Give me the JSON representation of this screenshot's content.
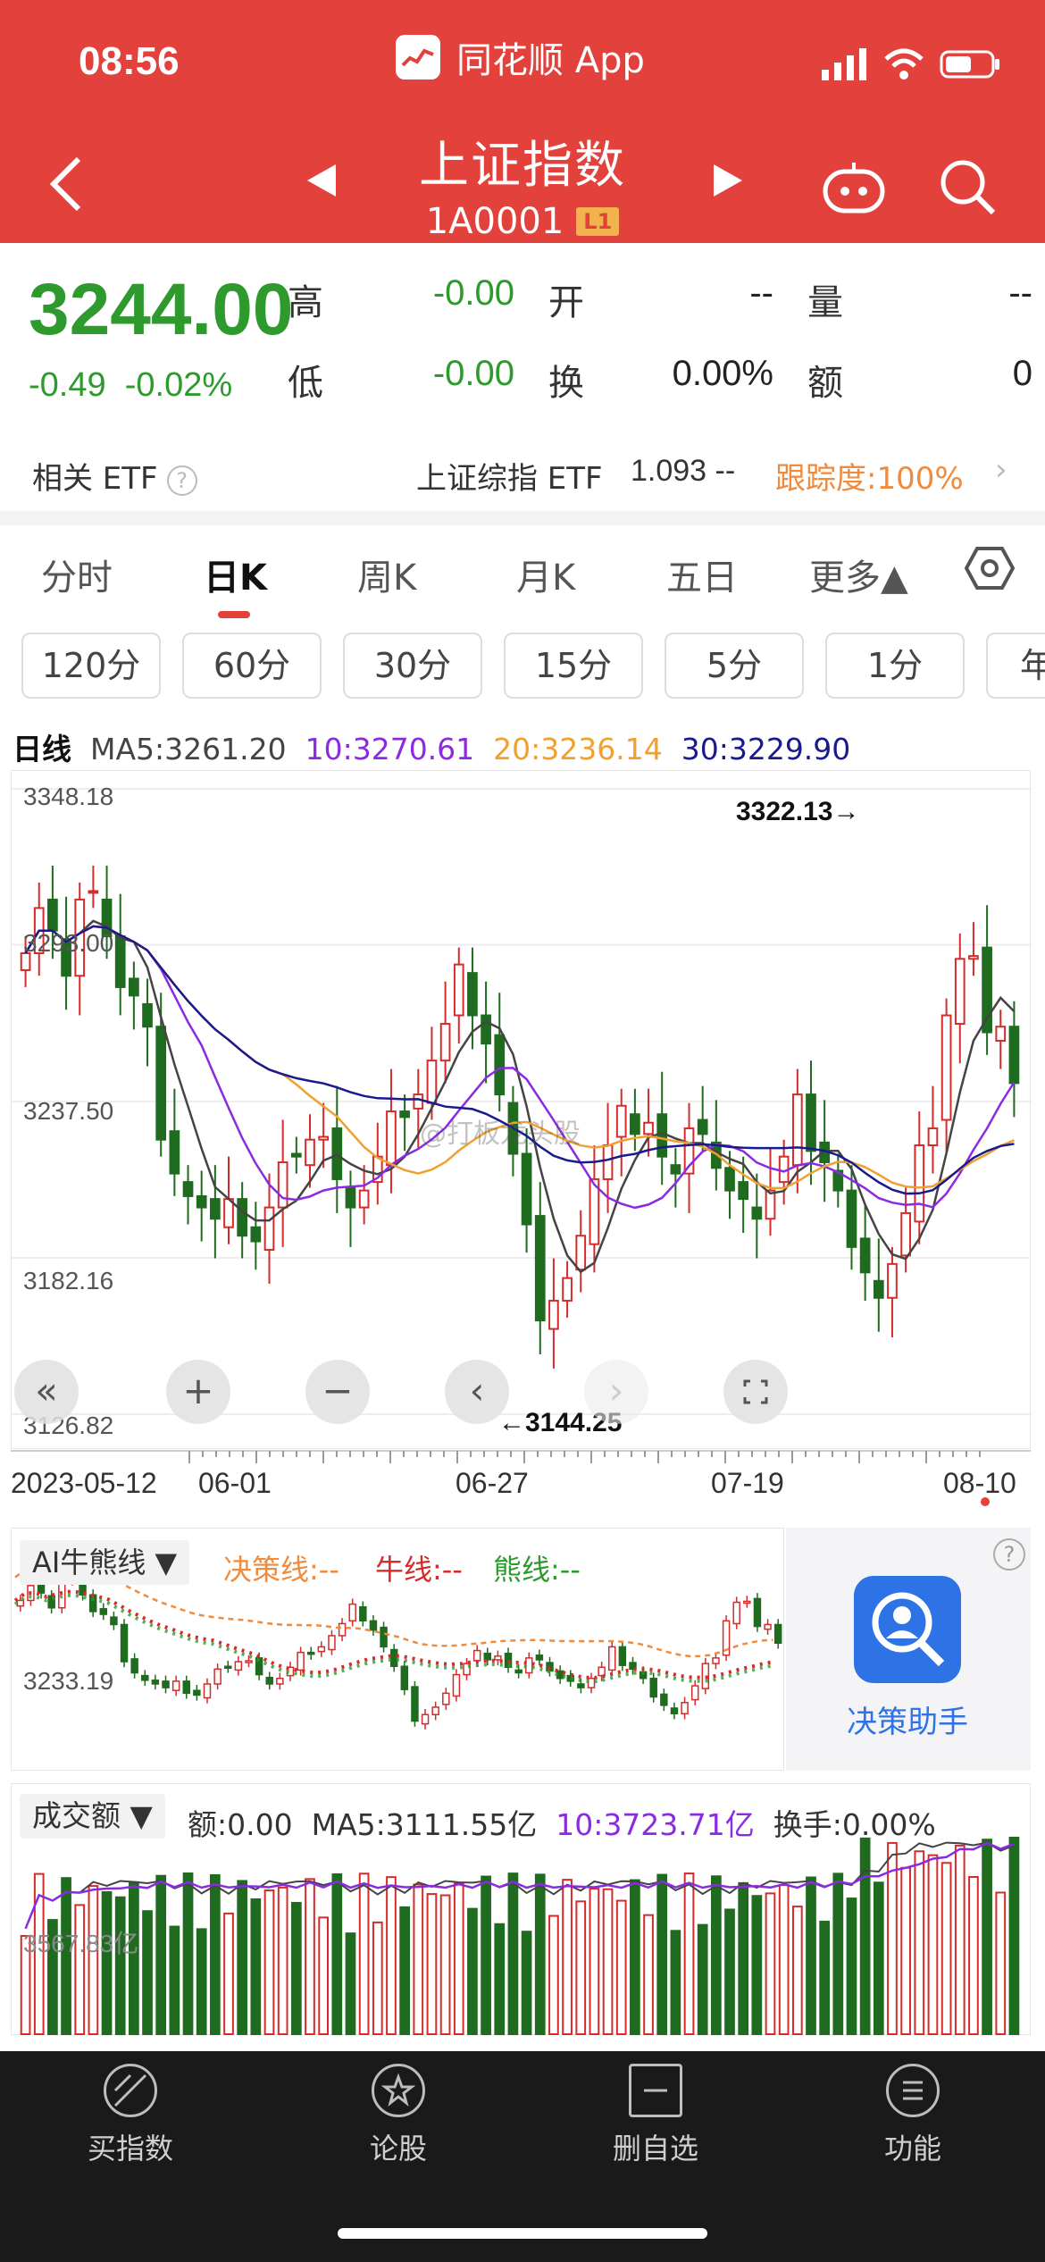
{
  "status_bar": {
    "time": "08:56",
    "app_name": "同花顺 App"
  },
  "header": {
    "title": "上证指数",
    "code": "1A0001",
    "level": "L1",
    "icons": [
      "back-icon",
      "prev-arrow-icon",
      "next-arrow-icon",
      "robot-icon",
      "search-icon"
    ]
  },
  "quote": {
    "price": "3244.00",
    "change": "-0.49",
    "change_pct": "-0.02%",
    "high_label": "高",
    "high": "-0.00",
    "low_label": "低",
    "low": "-0.00",
    "open_label": "开",
    "open": "--",
    "turnover_label": "换",
    "turnover": "0.00%",
    "volume_label": "量",
    "volume": "--",
    "amount_label": "额",
    "amount": "0"
  },
  "etf": {
    "label": "相关 ETF",
    "name": "上证综指 ETF",
    "price": "1.093",
    "price_change": "--",
    "tracking": "跟踪度:100%"
  },
  "tabs": [
    "分时",
    "日K",
    "周K",
    "月K",
    "五日",
    "更多▲"
  ],
  "active_tab": "日K",
  "chips": [
    "120分",
    "60分",
    "30分",
    "15分",
    "5分",
    "1分",
    "年"
  ],
  "ma_legend": {
    "period": "日线",
    "ma5": "MA5:3261.20",
    "ma10": "10:3270.61",
    "ma20": "20:3236.14",
    "ma30": "30:3229.90"
  },
  "colors": {
    "up": "#d52b2b",
    "down": "#1f6b1f",
    "ma5": "#444444",
    "ma10": "#8a2be2",
    "ma20": "#f0a030",
    "ma30": "#1a1a8c",
    "brand": "#e2413c"
  },
  "chart_data": {
    "type": "candlestick",
    "y_ticks": [
      "3348.18",
      "3293.00",
      "3237.50",
      "3182.16",
      "3126.82"
    ],
    "ylim": [
      3126.82,
      3348.18
    ],
    "x_ticks": [
      "2023-05-12",
      "06-01",
      "06-27",
      "07-19",
      "08-10"
    ],
    "annotations": {
      "high": "3322.13→",
      "low": "←3144.25"
    },
    "closes": [
      3290,
      3306,
      3298,
      3282,
      3309,
      3312,
      3296,
      3278,
      3275,
      3264,
      3224,
      3212,
      3204,
      3200,
      3196,
      3203,
      3190,
      3188,
      3200,
      3216,
      3218,
      3224,
      3225,
      3210,
      3200,
      3206,
      3218,
      3234,
      3232,
      3240,
      3252,
      3265,
      3286,
      3268,
      3258,
      3240,
      3219,
      3194,
      3160,
      3167,
      3175,
      3190,
      3210,
      3222,
      3236,
      3226,
      3230,
      3218,
      3212,
      3228,
      3226,
      3214,
      3206,
      3203,
      3196,
      3206,
      3218,
      3240,
      3220,
      3216,
      3206,
      3186,
      3177,
      3168,
      3180,
      3198,
      3222,
      3228,
      3268,
      3288,
      3289,
      3262,
      3264,
      3244
    ]
  },
  "ai_panel": {
    "label": "AI牛熊线 ▼",
    "decision": "决策线:--",
    "bull": "牛线:--",
    "bear": "熊线:--",
    "axis_value": "3233.19",
    "assistant": "决策助手"
  },
  "volume_panel": {
    "label": "成交额 ▼",
    "amount": "额:0.00",
    "ma5": "MA5:3111.55亿",
    "ma10": "10:3723.71亿",
    "turnover": "换手:0.00%",
    "axis_value": "3567.83亿"
  },
  "chart_controls": [
    "double-left-icon",
    "zoom-in-icon",
    "zoom-out-icon",
    "left-icon",
    "right-icon",
    "fullscreen-icon"
  ],
  "watermark": "@打板龙头股",
  "bottom_nav": [
    {
      "label": "买指数",
      "icon": "index-icon"
    },
    {
      "label": "论股",
      "icon": "badge-icon"
    },
    {
      "label": "删自选",
      "icon": "remove-watchlist-icon"
    },
    {
      "label": "功能",
      "icon": "menu-icon"
    }
  ]
}
